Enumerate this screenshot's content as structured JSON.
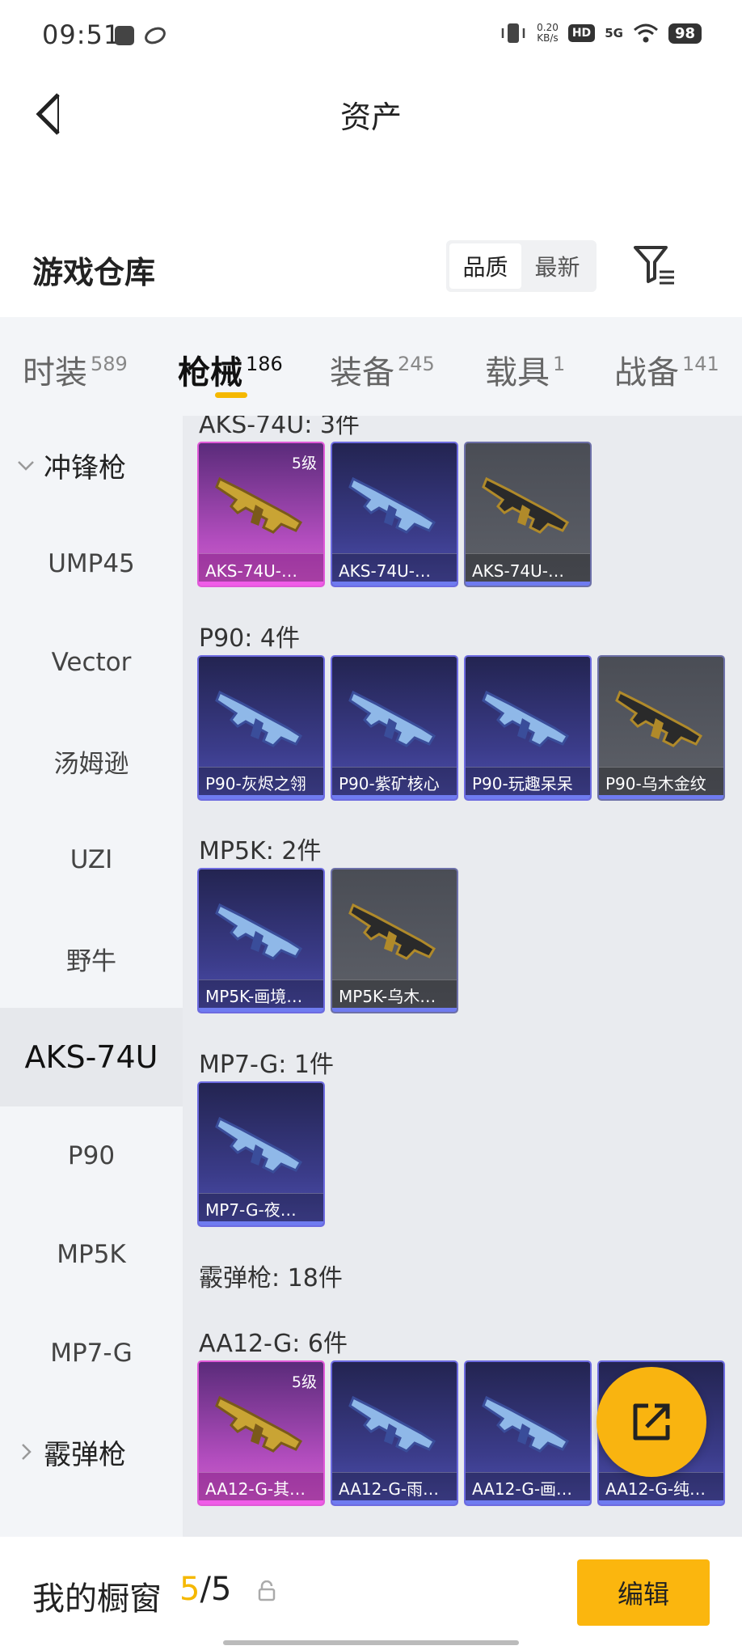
{
  "status_bar": {
    "time": "09:51",
    "net_speed_value": "0.20",
    "net_speed_unit": "KB/s",
    "hd_label": "HD",
    "network_label": "5G",
    "battery": "98"
  },
  "header": {
    "title": "资产"
  },
  "warehouse": {
    "title": "游戏仓库",
    "sort_options": [
      "品质",
      "最新"
    ],
    "sort_active": "品质"
  },
  "tabs": [
    {
      "label": "时装",
      "count": "589"
    },
    {
      "label": "枪械",
      "count": "186"
    },
    {
      "label": "装备",
      "count": "245"
    },
    {
      "label": "载具",
      "count": "1"
    },
    {
      "label": "战备",
      "count": "141"
    }
  ],
  "active_tab": "枪械",
  "sidebar": {
    "group_smg": "冲锋枪",
    "items": [
      "UMP45",
      "Vector",
      "汤姆逊",
      "UZI",
      "野牛",
      "AKS-74U",
      "P90",
      "MP5K",
      "MP7-G"
    ],
    "selected": "AKS-74U",
    "group_shotgun": "霰弹枪"
  },
  "sections": [
    {
      "title": "AKS-74U: 3件",
      "cards": [
        {
          "name": "AKS-74U-…",
          "quality": "pink",
          "level": "5级",
          "icon": "rifle-gold-icon"
        },
        {
          "name": "AKS-74U-…",
          "quality": "purple",
          "level": "",
          "icon": "rifle-blue-icon"
        },
        {
          "name": "AKS-74U-…",
          "quality": "gray",
          "level": "",
          "icon": "rifle-black-icon"
        }
      ]
    },
    {
      "title": "P90: 4件",
      "cards": [
        {
          "name": "P90-灰烬之翎",
          "quality": "purple",
          "level": "",
          "icon": "p90-ash-icon"
        },
        {
          "name": "P90-紫矿核心",
          "quality": "purple",
          "level": "",
          "icon": "p90-purple-icon"
        },
        {
          "name": "P90-玩趣呆呆",
          "quality": "purple",
          "level": "",
          "icon": "p90-green-icon"
        },
        {
          "name": "P90-乌木金纹",
          "quality": "gray",
          "level": "",
          "icon": "p90-black-icon"
        }
      ]
    },
    {
      "title": "MP5K: 2件",
      "cards": [
        {
          "name": "MP5K-画境…",
          "quality": "purple",
          "level": "",
          "icon": "mp5k-blue-icon"
        },
        {
          "name": "MP5K-乌木…",
          "quality": "gray",
          "level": "",
          "icon": "mp5k-gold-icon"
        }
      ]
    },
    {
      "title": "MP7-G: 1件",
      "cards": [
        {
          "name": "MP7-G-夜…",
          "quality": "purple",
          "level": "",
          "icon": "mp7-white-icon"
        }
      ]
    },
    {
      "title": "霰弹枪: 18件",
      "cards": []
    },
    {
      "title": "AA12-G: 6件",
      "cards": [
        {
          "name": "AA12-G-其…",
          "quality": "pink",
          "level": "5级",
          "icon": "aa12-gold-icon"
        },
        {
          "name": "AA12-G-雨…",
          "quality": "purple",
          "level": "",
          "icon": "aa12-mint-icon"
        },
        {
          "name": "AA12-G-画…",
          "quality": "purple",
          "level": "",
          "icon": "aa12-blue-icon"
        },
        {
          "name": "AA12-G-纯…",
          "quality": "purple",
          "level": "",
          "icon": "aa12-white-icon"
        }
      ]
    }
  ],
  "bottom_bar": {
    "label": "我的橱窗",
    "count_current": "5",
    "count_separator": "/",
    "count_total": "5",
    "edit_label": "编辑"
  },
  "colors": {
    "accent": "#f5b800",
    "fab": "#f9b410",
    "quality_pink": "#d065c8",
    "quality_purple": "#4e4fb0",
    "quality_gray": "#5e6169"
  }
}
